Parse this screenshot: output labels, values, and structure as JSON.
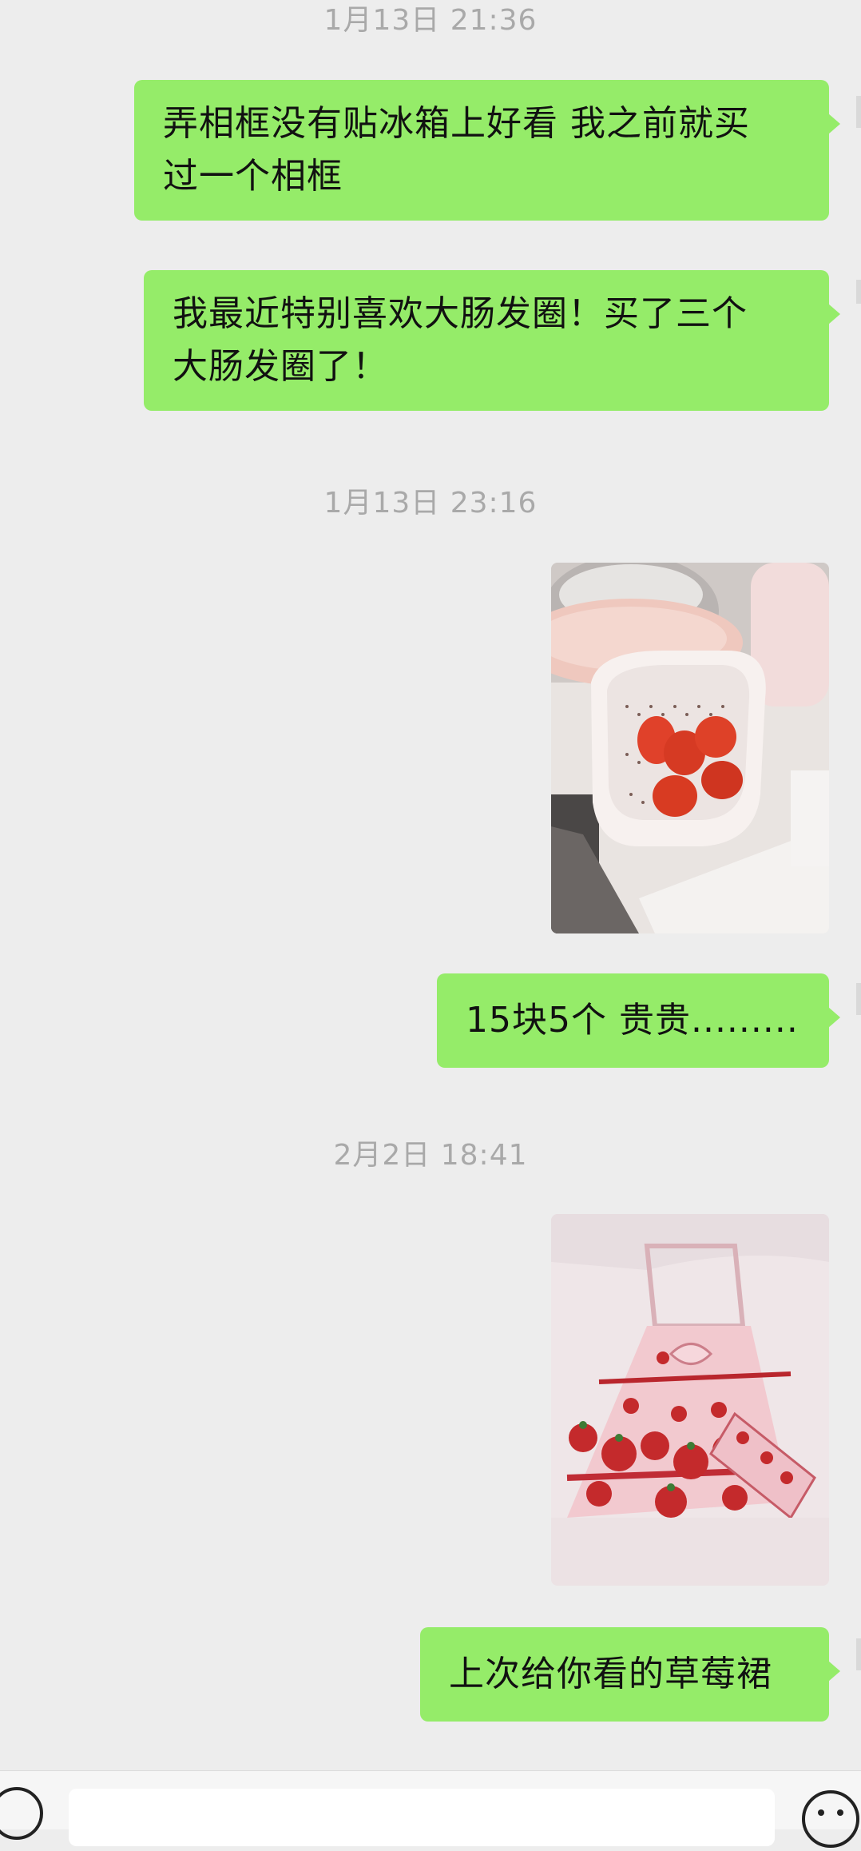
{
  "messages": [
    {
      "type": "timestamp",
      "text": "1月13日 21:36"
    },
    {
      "type": "text",
      "lines": [
        "弄相框没有贴冰箱上好看 我之前就买",
        "过一个相框"
      ]
    },
    {
      "type": "text",
      "lines": [
        "我最近特别喜欢大肠发圈！买了三个",
        "大肠发圈了！"
      ]
    },
    {
      "type": "timestamp",
      "text": "1月13日 23:16"
    },
    {
      "type": "image",
      "subject": "strawberries-in-colander"
    },
    {
      "type": "text",
      "lines": [
        "15块5个 贵贵........."
      ]
    },
    {
      "type": "timestamp",
      "text": "2月2日 18:41"
    },
    {
      "type": "image",
      "subject": "strawberry-print-dress"
    },
    {
      "type": "text",
      "lines": [
        "上次给你看的草莓裙"
      ]
    }
  ],
  "input_bar": {
    "placeholder": "",
    "voice_icon": "voice-icon",
    "emoji_icon": "emoji-icon"
  },
  "colors": {
    "background": "#ededed",
    "sent_bubble": "#95ec69",
    "timestamp": "#a9a9a9"
  }
}
